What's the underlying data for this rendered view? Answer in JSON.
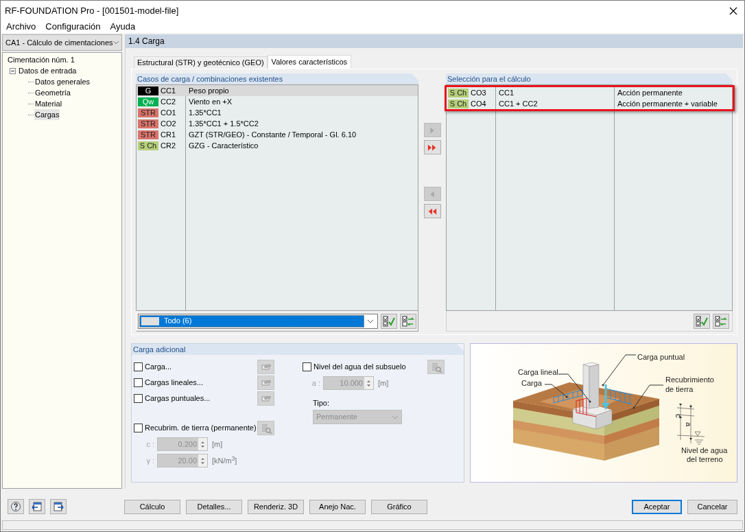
{
  "window": {
    "title": "RF-FOUNDATION Pro - [001501-model-file]"
  },
  "menu": [
    "Archivo",
    "Configuración",
    "Ayuda"
  ],
  "case_selector": {
    "value": "CA1 - Cálculo de cimentaciones"
  },
  "tree": [
    {
      "label": "Cimentación núm. 1",
      "selected": false,
      "children": [
        {
          "label": "Datos de entrada",
          "selected": false,
          "expanded": true,
          "children": [
            {
              "label": "Datos generales",
              "selected": false
            },
            {
              "label": "Geometría",
              "selected": false
            },
            {
              "label": "Material",
              "selected": false
            },
            {
              "label": "Cargas",
              "selected": true
            }
          ]
        }
      ]
    }
  ],
  "section_header": "1.4 Carga",
  "tabs": [
    {
      "label": "Estructural (STR) y geotécnico (GEO)",
      "selected": false
    },
    {
      "label": "Valores característicos",
      "selected": true
    }
  ],
  "existing": {
    "title": "Casos de carga / combinaciones existentes",
    "rows": [
      {
        "tag": "G",
        "color": "#000000",
        "id": "CC1",
        "description": "Peso propio",
        "selected": true
      },
      {
        "tag": "Qw",
        "color": "#00b050",
        "id": "CC2",
        "description": "Viento en +X",
        "selected": false
      },
      {
        "tag": "STR",
        "color": "#d9736b",
        "id": "CO1",
        "description": "1.35*CC1",
        "selected": false
      },
      {
        "tag": "STR",
        "color": "#d9736b",
        "id": "CO2",
        "description": "1.35*CC1 + 1.5*CC2",
        "selected": false
      },
      {
        "tag": "STR",
        "color": "#d9736b",
        "id": "CR1",
        "description": "GZT (STR/GEO) - Constante / Temporal - Gl. 6.10",
        "selected": false
      },
      {
        "tag": "S Ch",
        "color": "#b5cf7a",
        "id": "CR2",
        "description": "GZG - Característico",
        "selected": false
      }
    ],
    "filter": {
      "value": "Todo (6)"
    }
  },
  "transfer_buttons": [
    {
      "kind": "add",
      "disabled": true
    },
    {
      "kind": "add_all",
      "disabled": false
    },
    {
      "kind": "remove",
      "disabled": true
    },
    {
      "kind": "remove_all",
      "disabled": false
    }
  ],
  "selection": {
    "title": "Selección para el cálculo",
    "rows": [
      {
        "tag": "S Ch",
        "color": "#b5cf7a",
        "id": "CO3",
        "combination": "CC1",
        "description": "Acción permanente"
      },
      {
        "tag": "S Ch",
        "color": "#b5cf7a",
        "id": "CO4",
        "combination": "CC1 + CC2",
        "description": "Acción permanente + variable"
      }
    ]
  },
  "additional": {
    "title": "Carga adicional",
    "options": [
      {
        "label": "Carga...",
        "checked": false
      },
      {
        "label": "Cargas lineales...",
        "checked": false
      },
      {
        "label": "Cargas puntuales...",
        "checked": false
      }
    ],
    "cover": {
      "label": "Recubrim. de tierra (permanente)",
      "checked": false,
      "fields": [
        {
          "label": "c :",
          "value": "0.200",
          "unit": "[m]",
          "disabled": true
        },
        {
          "label": "γ :",
          "value": "20.00",
          "unit": "[kN/m$^{3}$]",
          "disabled": true
        }
      ]
    },
    "groundwater": {
      "label": "Nivel del agua del subsuelo",
      "checked": false,
      "field": {
        "label": "a :",
        "value": "10.000",
        "unit": "[m]",
        "disabled": true
      },
      "type_label": "Tipo:",
      "type": {
        "value": "Permanente",
        "disabled": true
      }
    }
  },
  "diagram": {
    "point_load": "Carga puntual",
    "line_load": "Carga lineal",
    "load": "Carga",
    "cover": [
      "Recubrimiento",
      "de tierra"
    ],
    "water": [
      "Nivel de agua",
      "del terreno"
    ],
    "dim_c": "c",
    "dim_a": "a"
  },
  "footer_buttons": [
    "Cálculo",
    "Detalles...",
    "Renderiz. 3D",
    "Anejo Nac.",
    "Gráfico"
  ],
  "dialog_buttons": [
    {
      "label": "Aceptar",
      "default": true
    },
    {
      "label": "Cancelar",
      "default": false
    }
  ]
}
